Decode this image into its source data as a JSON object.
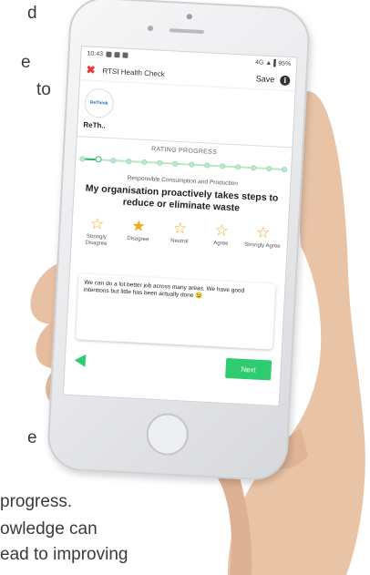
{
  "background_text": {
    "line1": "d",
    "line2": "e",
    "line3": "to",
    "line4": "e",
    "line5": "progress.",
    "line6": "owledge can",
    "line7": "ead to improving"
  },
  "status_bar": {
    "time": "10:43",
    "right": "4G ▲ ▌95%"
  },
  "header": {
    "title": "RTSI Health Check",
    "save_label": "Save",
    "info_glyph": "i",
    "close_glyph": "✖"
  },
  "org": {
    "logo_text": "ReThink",
    "name": "ReTh.."
  },
  "progress": {
    "label": "RATING PROGRESS",
    "steps": 14,
    "current_step": 1
  },
  "question": {
    "category": "Responsible Consumption and Production",
    "text": "My organisation proactively takes steps to reduce or eliminate waste"
  },
  "rating": {
    "selected_index": 1,
    "options": [
      {
        "label": "Strongly Disagree"
      },
      {
        "label": "Disagree"
      },
      {
        "label": "Neutral"
      },
      {
        "label": "Agree"
      },
      {
        "label": "Strongly Agree"
      }
    ],
    "star_color": "#f0a818"
  },
  "comment": {
    "text": "We can do a lot better job across many areas. We have good intentions but little has been actually done 😉"
  },
  "nav": {
    "next_label": "Next",
    "accent": "#2ecc71"
  }
}
